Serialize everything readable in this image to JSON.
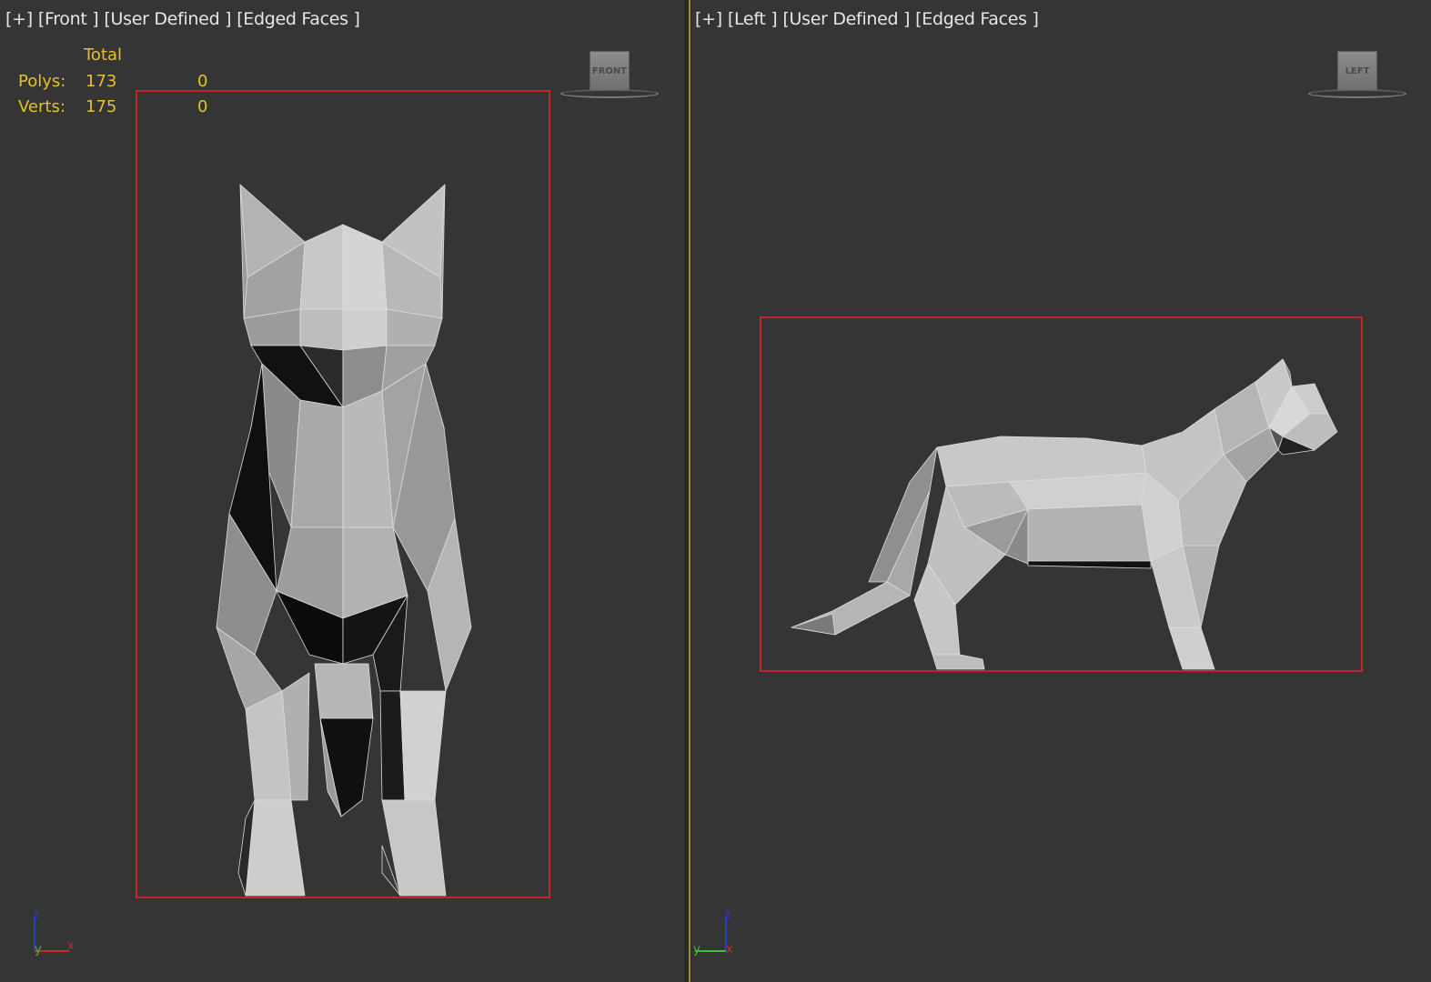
{
  "front_viewport": {
    "label_plus": "[+]",
    "label_view": "[Front ]",
    "label_camera": "[User Defined ]",
    "label_shading": "[Edged Faces ]",
    "viewcube_face": "FRONT",
    "axis_icon": "xyz-axis-tripod-icon"
  },
  "left_viewport": {
    "label_plus": "[+]",
    "label_view": "[Left ]",
    "label_camera": "[User Defined ]",
    "label_shading": "[Edged Faces ]",
    "viewcube_face": "LEFT",
    "axis_icon": "xyz-axis-tripod-icon"
  },
  "stats": {
    "header": "Total",
    "rows": [
      {
        "label": "Polys:",
        "total": "173",
        "selected": "0"
      },
      {
        "label": "Verts:",
        "total": "175",
        "selected": "0"
      }
    ]
  },
  "colors": {
    "background": "#353535",
    "stats_text": "#e6c229",
    "selection_box": "#c0272d",
    "active_border": "#a08a3c",
    "mesh_light": "#bdbdbd",
    "mesh_dark": "#111111"
  },
  "axis_labels": {
    "z": "z",
    "x": "x",
    "y": "y"
  }
}
